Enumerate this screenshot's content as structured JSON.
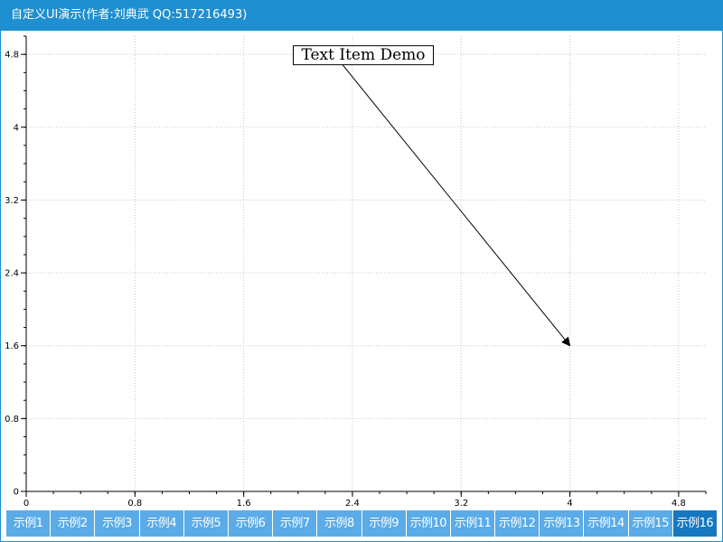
{
  "window": {
    "title": "自定义UI演示(作者:刘典武 QQ:517216493)"
  },
  "colors": {
    "title_bar": "#1E8FD0",
    "tab_bg": "#5AABE8",
    "tab_active_bg": "#1578C0",
    "grid": "#c8c8c8",
    "axis": "#000000"
  },
  "chart_data": {
    "type": "scatter",
    "xlim": [
      0,
      5
    ],
    "ylim": [
      0,
      5
    ],
    "x_ticks": [
      "0",
      "0.8",
      "1.6",
      "2.4",
      "3.2",
      "4",
      "4.8"
    ],
    "y_ticks": [
      "0",
      "0.8",
      "1.6",
      "2.4",
      "3.2",
      "4",
      "4.8"
    ],
    "grid": true,
    "annotation": {
      "text": "Text Item Demo",
      "label_at": [
        2.5,
        4.8
      ],
      "arrow_to": [
        4.0,
        1.6
      ]
    }
  },
  "tabs": [
    {
      "label": "示例1",
      "active": false
    },
    {
      "label": "示例2",
      "active": false
    },
    {
      "label": "示例3",
      "active": false
    },
    {
      "label": "示例4",
      "active": false
    },
    {
      "label": "示例5",
      "active": false
    },
    {
      "label": "示例6",
      "active": false
    },
    {
      "label": "示例7",
      "active": false
    },
    {
      "label": "示例8",
      "active": false
    },
    {
      "label": "示例9",
      "active": false
    },
    {
      "label": "示例10",
      "active": false
    },
    {
      "label": "示例11",
      "active": false
    },
    {
      "label": "示例12",
      "active": false
    },
    {
      "label": "示例13",
      "active": false
    },
    {
      "label": "示例14",
      "active": false
    },
    {
      "label": "示例15",
      "active": false
    },
    {
      "label": "示例16",
      "active": true
    }
  ]
}
